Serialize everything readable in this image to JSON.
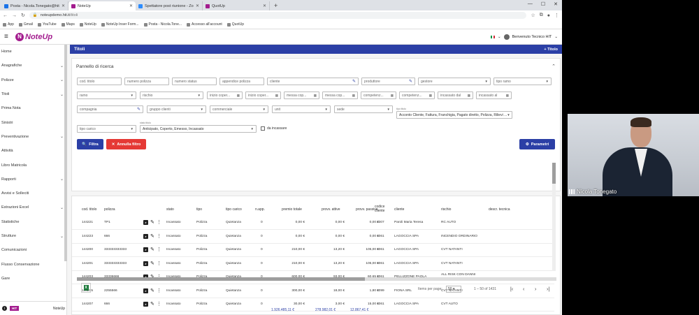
{
  "browser": {
    "tabs": [
      {
        "label": "Posta - Nicola.Tonegato@hit.it",
        "color": "#1a73e8",
        "active": false
      },
      {
        "label": "NoteUp",
        "color": "#a31c8e",
        "active": true
      },
      {
        "label": "Spettatore post riunione - Zoom",
        "color": "#2d8cff",
        "active": false
      },
      {
        "label": "QuotUp",
        "color": "#a31c8e",
        "active": false
      }
    ],
    "url_host": "noteupdemo.hit.it",
    "url_path": "/titoli",
    "bookmarks": [
      "App",
      "Gmail",
      "YouTube",
      "Maps",
      "NoteUp",
      "NoteUp Inser Form...",
      "Posta - Nicola.Tone...",
      "Accesso all'account",
      "QuotUp"
    ]
  },
  "app": {
    "logo_text": "NoteUp",
    "user_name": "Benvenuto Tecnico HIT"
  },
  "sidebar": {
    "items": [
      {
        "label": "Home",
        "chevron": false
      },
      {
        "label": "Anagrafiche",
        "chevron": true
      },
      {
        "label": "Polizze",
        "chevron": true
      },
      {
        "label": "Titoli",
        "chevron": true
      },
      {
        "label": "Prima Nota",
        "chevron": false
      },
      {
        "label": "Sinistri",
        "chevron": false
      },
      {
        "label": "Preventivazione",
        "chevron": true
      },
      {
        "label": "Attività",
        "chevron": false
      },
      {
        "label": "Libro Matricola",
        "chevron": false
      },
      {
        "label": "Rapporti",
        "chevron": true
      },
      {
        "label": "Avvisi e Solleciti",
        "chevron": false
      },
      {
        "label": "Estrazioni Excel",
        "chevron": true
      },
      {
        "label": "Statistiche",
        "chevron": false
      },
      {
        "label": "Strutture",
        "chevron": true
      },
      {
        "label": "Comunicazioni",
        "chevron": false
      },
      {
        "label": "Flusso Conservazione",
        "chevron": false
      },
      {
        "label": "Gare",
        "chevron": false
      }
    ],
    "footer_badge": "HIT",
    "footer_label": "NoteUp"
  },
  "page": {
    "title": "Titoli",
    "add_label": "Titolo"
  },
  "search": {
    "title": "Pannello di ricerca",
    "row1": [
      "cod. titolo",
      "numero polizza",
      "numero status",
      "appendice polizza",
      "cliente",
      "produttore",
      "gestore",
      "tipo ramo"
    ],
    "row2": [
      "ramo",
      "rischio",
      "inizio coper...",
      "inizio coper...",
      "messa cop...",
      "messa cop...",
      "competenz...",
      "competenz...",
      "incassato dal",
      "incassato al"
    ],
    "row3": [
      "compagnia",
      "gruppo clienti",
      "commerciale",
      "unit",
      "sede"
    ],
    "tipo_titolo_label": "tipo titolo",
    "tipo_titolo_value": "Acconto Cliente, Fattura, Franchigia, Pagato diretto, Polizza, Rilievi ...",
    "tipo_carico": "tipo carico",
    "stato_titolo_label": "stato titolo",
    "stato_titolo_value": "Anticipato, Coperto, Emesso, Incassato",
    "da_incassare": "da incassare",
    "btn_filtra": "Filtra",
    "btn_annulla": "Annulla filtro",
    "btn_parametri": "Parametri"
  },
  "results": {
    "columns": [
      "cod. titolo",
      "polizza",
      "stato",
      "tipo",
      "tipo carico",
      "n.app.",
      "premio totale",
      "provv. attive",
      "provv. passive",
      "codice cliente",
      "cliente",
      "rischio",
      "descr. tecnica"
    ],
    "rows": [
      [
        "144221",
        "TP1",
        "Incassato",
        "Polizza",
        "Quietanza",
        "0",
        "0,00 €",
        "0,00 €",
        "0,00 €",
        "2307",
        "Paroli Maria Teresa",
        "RC AUTO"
      ],
      [
        "144223",
        "666",
        "Incassato",
        "Polizza",
        "Quietanza",
        "0",
        "0,00 €",
        "0,00 €",
        "0,00 €",
        "1061",
        "LAGOCCIA SPA",
        "INCENDIO ORDINARIO"
      ],
      [
        "144200",
        "333333333333",
        "Incassato",
        "Polizza",
        "Quietanza",
        "0",
        "210,00 €",
        "13,20 €",
        "105,00 €",
        "1061",
        "LAGOCCIA SPA",
        "CVT NATANTI"
      ],
      [
        "144201",
        "333333333333",
        "Incassato",
        "Polizza",
        "Quietanza",
        "0",
        "210,00 €",
        "13,20 €",
        "105,00 €",
        "1061",
        "LAGOCCIA SPA",
        "CVT NATANTI"
      ],
      [
        "144203",
        "33336666",
        "Incassato",
        "Polizza",
        "Quietanza",
        "0",
        "600,00 €",
        "93,00 €",
        "60,65 €",
        "1061",
        "PELLIZZONE PAOLA",
        "ALL RISK CON DANNI INDIRETTI"
      ],
      [
        "144205",
        "2255566",
        "Incassato",
        "Polizza",
        "Quietanza",
        "0",
        "300,00 €",
        "18,00 €",
        "1,80 €",
        "1099",
        "FIONA SRL",
        "CVT NATANTI"
      ],
      [
        "144207",
        "666",
        "Incassato",
        "Polizza",
        "Quietanza",
        "0",
        "30,00 €",
        "3,00 €",
        "15,00 €",
        "1061",
        "LAGOCCIA SPA",
        "CVT AUTO"
      ]
    ],
    "totals": [
      "1.926.485,11 €",
      "278.982,01 €",
      "12.867,41 €"
    ],
    "items_per_page_label": "Items per page:",
    "items_per_page": "50",
    "range": "1 – 50 of 1431"
  },
  "video": {
    "participant_name": "Nicola Tonegato"
  }
}
